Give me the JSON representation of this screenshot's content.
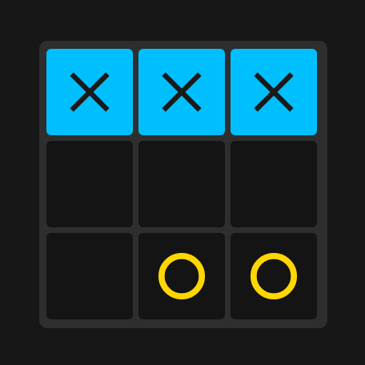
{
  "game": {
    "board": [
      [
        "X",
        "X",
        "X"
      ],
      [
        "",
        "",
        ""
      ],
      [
        "",
        "O",
        "O"
      ]
    ],
    "winning_cells": [
      [
        0,
        0
      ],
      [
        0,
        1
      ],
      [
        0,
        2
      ]
    ],
    "winner": "X"
  },
  "colors": {
    "background": "#171717",
    "board": "#2e2e2e",
    "cell": "#141414",
    "win_highlight": "#00bfff",
    "x_mark": "#1a1a1a",
    "o_mark": "#ffd700"
  },
  "icons": {
    "x": "x-mark-icon",
    "o": "o-mark-icon"
  }
}
